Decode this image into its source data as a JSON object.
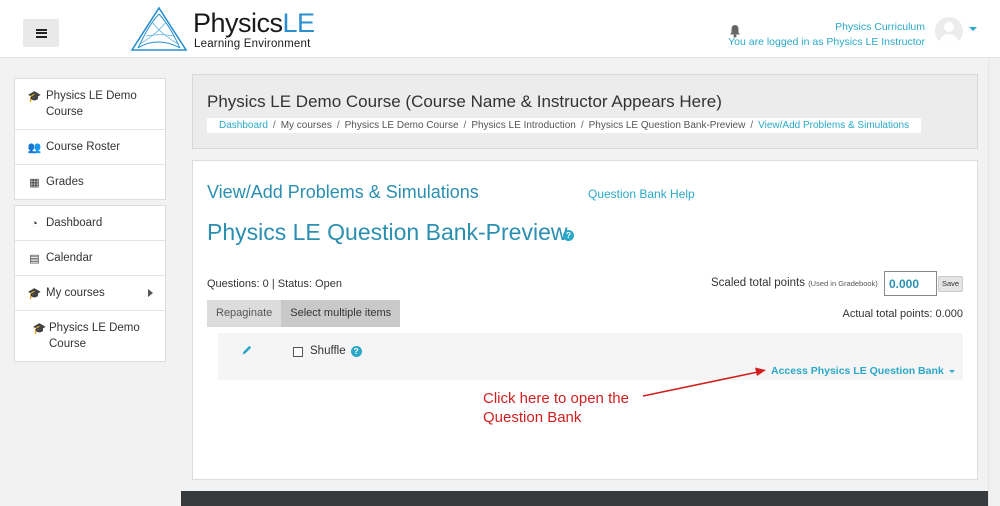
{
  "navbar": {
    "logo_main": "Physics",
    "logo_le": "LE",
    "logo_sub": "Learning Environment",
    "user_name": "Physics Curriculum",
    "login_status": "You are logged in as Physics LE Instructor"
  },
  "sidebar": {
    "group1": [
      {
        "label": "Physics LE Demo Course",
        "icon": "graduation-cap-icon"
      },
      {
        "label": "Course Roster",
        "icon": "users-icon"
      },
      {
        "label": "Grades",
        "icon": "table-icon"
      }
    ],
    "group2": [
      {
        "label": "Dashboard",
        "icon": "dashboard-icon"
      },
      {
        "label": "Calendar",
        "icon": "calendar-icon"
      },
      {
        "label": "My courses",
        "icon": "graduation-cap-icon"
      },
      {
        "label": "Physics LE Demo Course",
        "icon": "graduation-cap-icon"
      }
    ]
  },
  "course_header": {
    "title": "Physics LE Demo Course (Course Name & Instructor Appears Here)",
    "breadcrumb": [
      {
        "label": "Dashboard"
      },
      {
        "label": "My courses"
      },
      {
        "label": "Physics LE Demo Course"
      },
      {
        "label": "Physics LE Introduction"
      },
      {
        "label": "Physics LE Question Bank-Preview"
      },
      {
        "label": "View/Add Problems & Simulations"
      }
    ]
  },
  "main": {
    "view_title": "View/Add Problems & Simulations",
    "help_link": "Question Bank Help",
    "qb_title": "Physics LE Question Bank-Preview",
    "questions_status": "Questions: 0 | Status: Open",
    "scaled_label": "Scaled total points",
    "scaled_note": "(Used in Gradebook)",
    "points_value": "0.000",
    "save_label": "Save",
    "repaginate_label": "Repaginate",
    "select_multiple_label": "Select multiple items",
    "actual_points": "Actual total points: 0.000",
    "shuffle_label": "Shuffle",
    "access_label": "Access Physics LE Question Bank",
    "qmark": "?"
  },
  "annotation": {
    "line1": "Click here to open the",
    "line2": "Question Bank",
    "color": "#d11f1f"
  },
  "colors": {
    "accent": "#2aa8c8",
    "title_blue": "#2a8fb0",
    "footer": "#373a3c"
  }
}
